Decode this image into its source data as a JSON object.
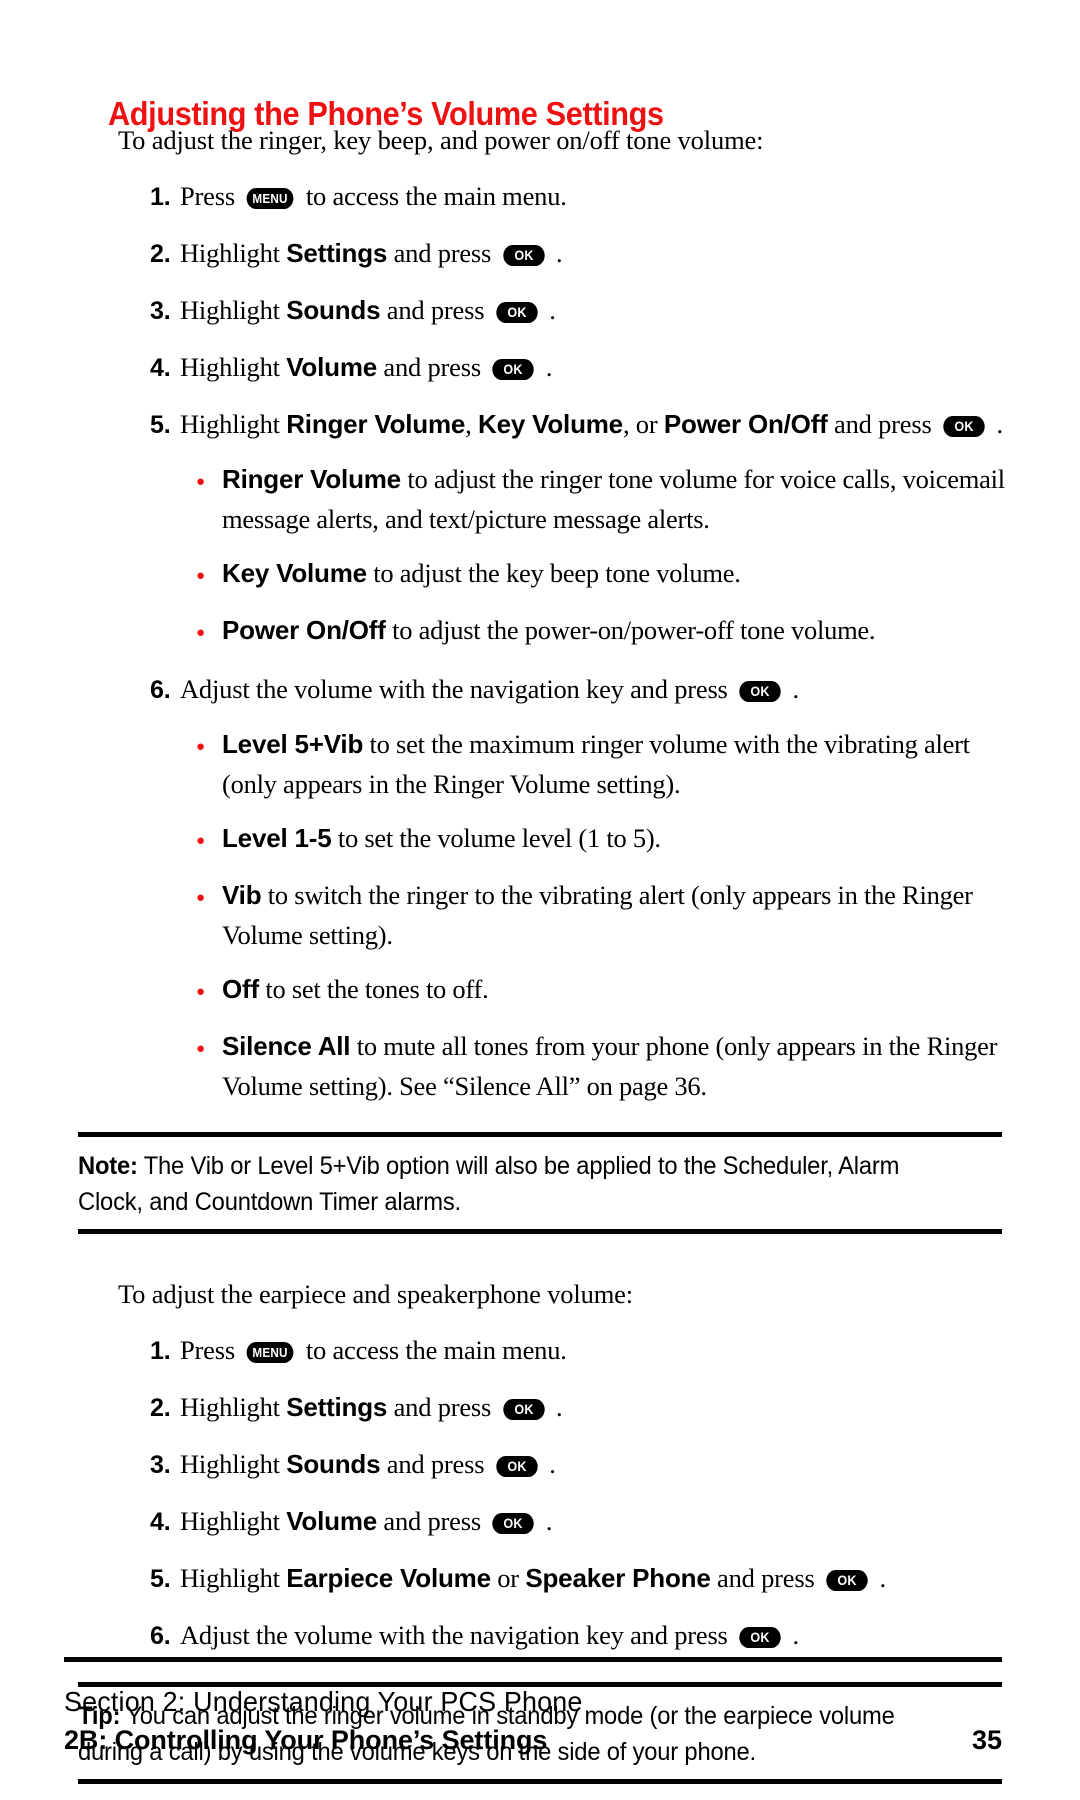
{
  "page": {
    "title": "Adjusting the Phone’s Volume Settings",
    "title_color": "#ee1111",
    "bullet_color": "#ee1111",
    "page_number": "35"
  },
  "section_one": {
    "lead": "To adjust the ringer, key beep, and power on/off tone volume:",
    "steps": [
      {
        "num": "1.",
        "pre": "Press ",
        "key": "MENU",
        "post": " to access the main menu."
      },
      {
        "num": "2.",
        "pre": "Highlight ",
        "bold": "Settings",
        "mid": " and press ",
        "key": "OK",
        "post": " ."
      },
      {
        "num": "3.",
        "pre": "Highlight ",
        "bold": "Sounds",
        "mid": " and press ",
        "key": "OK",
        "post": " ."
      },
      {
        "num": "4.",
        "pre": "Highlight ",
        "bold": "Volume",
        "mid": " and press ",
        "key": "OK",
        "post": " ."
      },
      {
        "num": "5.",
        "pre": "Highlight ",
        "bold_a": "Ringer Volume",
        "sep_a": ", ",
        "bold_b": "Key Volume",
        "sep_b": ", or ",
        "bold_c": "Power On/Off",
        "mid": " and press ",
        "key": "OK",
        "post": " ."
      }
    ],
    "bullets_after_step5": [
      {
        "label": "Ringer Volume",
        "text": " to adjust the ringer tone volume for voice calls, voicemail message alerts, and text/picture message alerts."
      },
      {
        "label": "Key Volume",
        "text": " to adjust the key beep tone volume."
      },
      {
        "label": "Power On/Off",
        "text": " to adjust the power-on/power-off tone volume."
      }
    ],
    "step6": {
      "num": "6.",
      "pre": "Adjust the volume with the navigation key and press ",
      "key": "OK",
      "post": " ."
    },
    "bullets_after_step6": [
      {
        "label": "Level 5+Vib",
        "text": " to set the maximum ringer volume with the vibrating alert (only appears in the Ringer Volume setting)."
      },
      {
        "label": "Level 1-5",
        "text": " to set the volume level (1 to 5)."
      },
      {
        "label": "Vib",
        "text": " to switch the ringer to the vibrating alert (only appears in the Ringer Volume setting)."
      },
      {
        "label": "Off",
        "text": " to set the tones to off."
      },
      {
        "label": "Silence All",
        "text": " to mute all tones from your phone (only appears in the Ringer Volume setting). See “Silence All” on page 36."
      }
    ]
  },
  "note": {
    "label": "Note:",
    "text": " The Vib or Level 5+Vib option will also be applied to the Scheduler, Alarm Clock, and Countdown Timer alarms."
  },
  "section_two": {
    "lead": "To adjust the earpiece and speakerphone volume:",
    "steps": [
      {
        "num": "1.",
        "pre": "Press ",
        "key": "MENU",
        "post": " to access the main menu."
      },
      {
        "num": "2.",
        "pre": "Highlight ",
        "bold": "Settings",
        "mid": " and press ",
        "key": "OK",
        "post": " ."
      },
      {
        "num": "3.",
        "pre": "Highlight ",
        "bold": "Sounds",
        "mid": " and press ",
        "key": "OK",
        "post": " ."
      },
      {
        "num": "4.",
        "pre": "Highlight ",
        "bold": "Volume",
        "mid": " and press ",
        "key": "OK",
        "post": " ."
      },
      {
        "num": "5.",
        "pre": "Highlight ",
        "bold_a": "Earpiece Volume",
        "sep_a": " or ",
        "bold_b": "Speaker Phone",
        "mid": " and press ",
        "key": "OK",
        "post": " ."
      },
      {
        "num": "6.",
        "pre": "Adjust the volume with the navigation key and press ",
        "key": "OK",
        "post": " ."
      }
    ]
  },
  "tip": {
    "label": "Tip:",
    "text": " You can adjust the ringer volume in standby mode (or the earpiece volume during a call) by using the volume keys on the side of your phone."
  },
  "footer": {
    "line1": "Section 2: Understanding Your PCS Phone",
    "line2": "2B: Controlling Your Phone’s Settings",
    "page_number": "35"
  }
}
